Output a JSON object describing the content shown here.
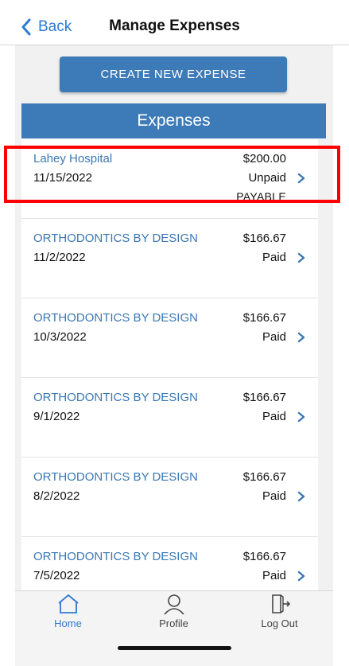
{
  "nav": {
    "back_label": "Back",
    "title": "Manage Expenses"
  },
  "create_button_label": "CREATE NEW EXPENSE",
  "section_title": "Expenses",
  "expenses": [
    {
      "name": "Lahey Hospital",
      "date": "11/15/2022",
      "amount": "$200.00",
      "status": "Unpaid",
      "type": "PAYABLE"
    },
    {
      "name": "ORTHODONTICS BY DESIGN",
      "date": "11/2/2022",
      "amount": "$166.67",
      "status": "Paid",
      "type": ""
    },
    {
      "name": "ORTHODONTICS BY DESIGN",
      "date": "10/3/2022",
      "amount": "$166.67",
      "status": "Paid",
      "type": ""
    },
    {
      "name": "ORTHODONTICS BY DESIGN",
      "date": "9/1/2022",
      "amount": "$166.67",
      "status": "Paid",
      "type": ""
    },
    {
      "name": "ORTHODONTICS BY DESIGN",
      "date": "8/2/2022",
      "amount": "$166.67",
      "status": "Paid",
      "type": ""
    },
    {
      "name": "ORTHODONTICS BY DESIGN",
      "date": "7/5/2022",
      "amount": "$166.67",
      "status": "Paid",
      "type": ""
    }
  ],
  "tabbar": {
    "home_label": "Home",
    "profile_label": "Profile",
    "logout_label": "Log Out",
    "active": "home"
  },
  "colors": {
    "accent": "#3d7ab8",
    "link": "#2f7ad0",
    "highlight": "#ff0000"
  },
  "icons": [
    "chevron-left-icon",
    "chevron-right-icon",
    "home-icon",
    "profile-icon",
    "logout-icon"
  ]
}
